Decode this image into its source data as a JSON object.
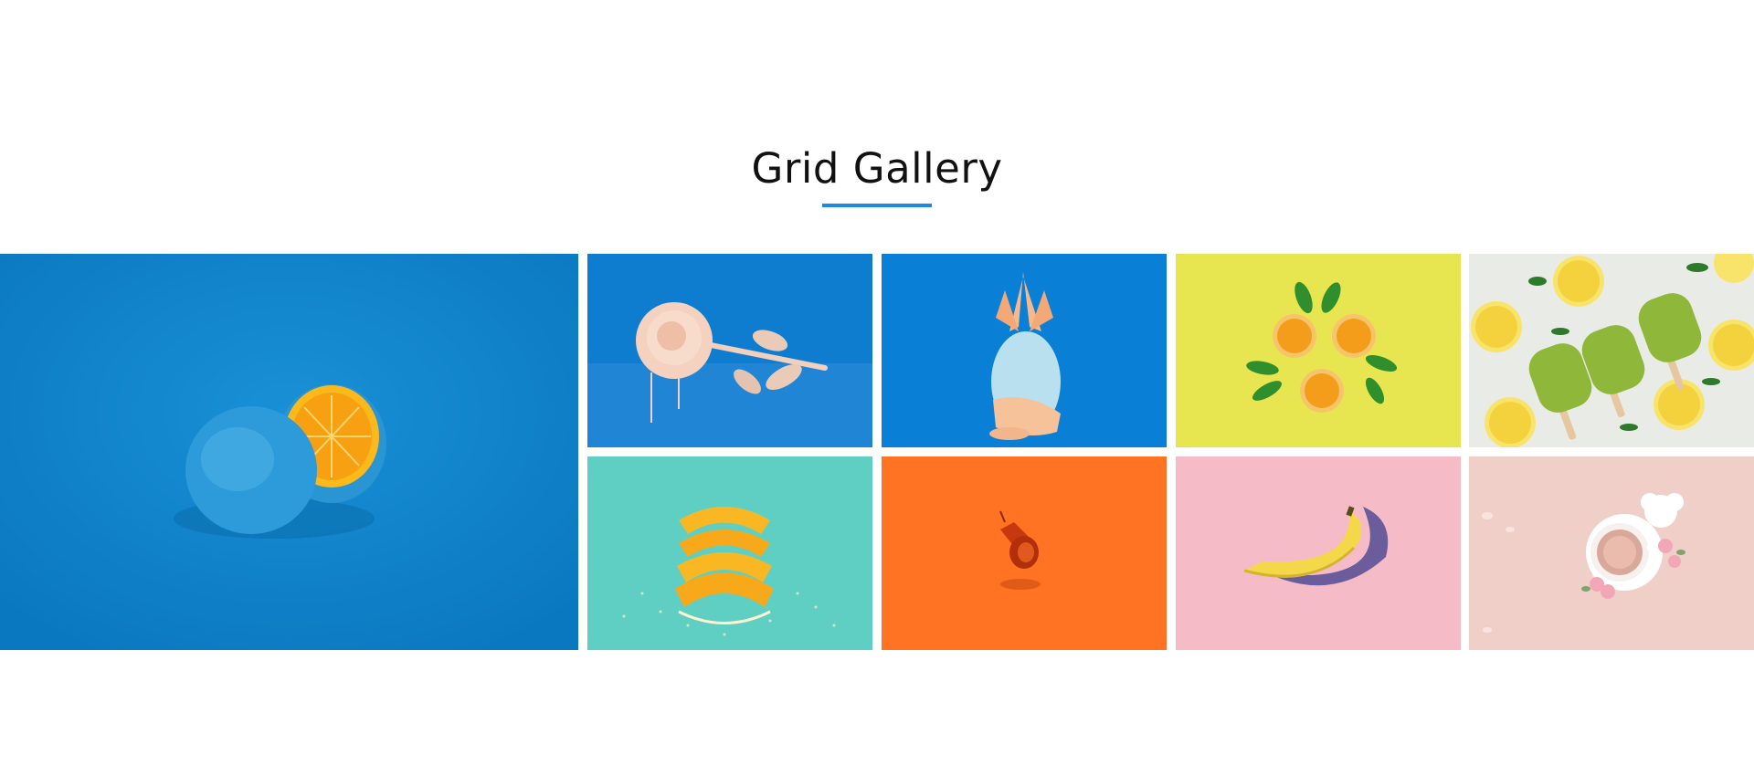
{
  "header": {
    "title": "Grid Gallery",
    "accent_color": "#1e88e5"
  },
  "gallery": {
    "tiles": [
      {
        "subject": "blue-painted-orange",
        "background": "#0b80c8"
      },
      {
        "subject": "peach-rose",
        "background": "#0f7dcf"
      },
      {
        "subject": "painted-pineapple",
        "background": "#0a7fd6"
      },
      {
        "subject": "orange-slices-with-leaves",
        "background": "#e7e44a"
      },
      {
        "subject": "lime-popsicles-with-lemons",
        "background": "#e9ebe6"
      },
      {
        "subject": "orange-wedges",
        "background": "#5fcfc4"
      },
      {
        "subject": "red-megaphone",
        "background": "#ff7322"
      },
      {
        "subject": "banana",
        "background": "#f5bcc8"
      },
      {
        "subject": "coffee-cup-with-flowers",
        "background": "#f1cfc9"
      }
    ]
  }
}
